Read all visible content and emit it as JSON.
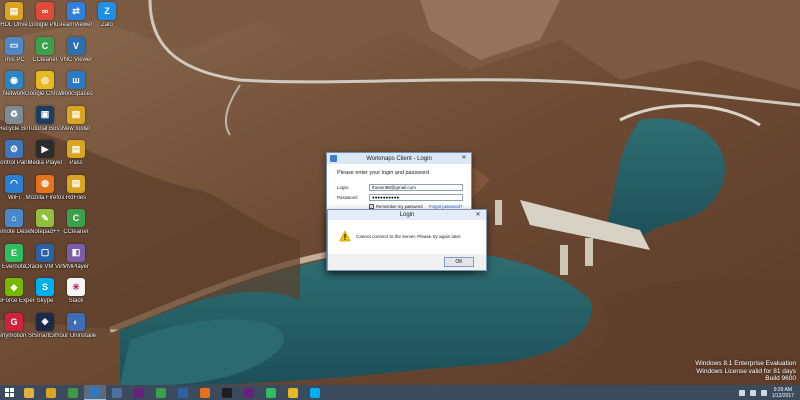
{
  "desktop_icons": [
    {
      "name": "folder-icon",
      "label": "HDL Drive",
      "color": "#d9a520",
      "glyph": "▤"
    },
    {
      "name": "google-plus-icon",
      "label": "Google Plus",
      "color": "#dd4b39",
      "glyph": "∞"
    },
    {
      "name": "teamviewer-icon",
      "label": "TeamViewer",
      "color": "#2f7fe0",
      "glyph": "⇄"
    },
    {
      "name": "zalo-icon",
      "label": "Zalo",
      "color": "#1d8fe6",
      "glyph": "Z"
    },
    {
      "name": "computer-icon",
      "label": "This PC",
      "color": "#4e88c7",
      "glyph": "▭"
    },
    {
      "name": "ccleaner-icon",
      "label": "CCleaner",
      "color": "#3aa04a",
      "glyph": "C"
    },
    {
      "name": "vnc-viewer-icon",
      "label": "VNC Viewer",
      "color": "#2e6fb0",
      "glyph": "V"
    },
    {
      "name": "network-icon",
      "label": "Network",
      "color": "#2b86c8",
      "glyph": "◉"
    },
    {
      "name": "chrome-icon",
      "label": "Google Chrome",
      "color": "#e8b821",
      "glyph": "◎"
    },
    {
      "name": "workspaces-icon",
      "label": "WorkSpaces",
      "color": "#2f78c4",
      "glyph": "ш"
    },
    {
      "name": "recycle-bin-icon",
      "label": "Recycle Bin",
      "color": "#7d8c99",
      "glyph": "♻"
    },
    {
      "name": "screen-icon",
      "label": "Tutorial Boss",
      "color": "#1c3d64",
      "glyph": "▣"
    },
    {
      "name": "new-folder-icon",
      "label": "New folder",
      "color": "#d9a520",
      "glyph": "▤"
    },
    {
      "name": "control-panel-icon",
      "label": "Control Panel",
      "color": "#3b78c0",
      "glyph": "⚙"
    },
    {
      "name": "media-player-icon",
      "label": "Media Player",
      "color": "#2c2c2c",
      "glyph": "▶"
    },
    {
      "name": "folder2-icon",
      "label": "Pass",
      "color": "#d9a520",
      "glyph": "▤"
    },
    {
      "name": "wifi-icon",
      "label": "WiFi",
      "color": "#2b7fd0",
      "glyph": "◠"
    },
    {
      "name": "firefox-icon",
      "label": "Mozilla Firefox",
      "color": "#e6731c",
      "glyph": "◍"
    },
    {
      "name": "folder3-icon",
      "label": "RdFiles",
      "color": "#d9a520",
      "glyph": "▤"
    },
    {
      "name": "remote-desktop-icon",
      "label": "Remote Desktop",
      "color": "#4a89c8",
      "glyph": "⌂"
    },
    {
      "name": "notepad-plus-icon",
      "label": "Notepad++",
      "color": "#8fbf3c",
      "glyph": "✎"
    },
    {
      "name": "ccleaner2-icon",
      "label": "CCleaner",
      "color": "#3aa04a",
      "glyph": "C"
    },
    {
      "name": "evernote-icon",
      "label": "Evernote",
      "color": "#2dbe60",
      "glyph": "E"
    },
    {
      "name": "virtualbox-icon",
      "label": "Oracle VM VirtualBox",
      "color": "#2a62a8",
      "glyph": "▢"
    },
    {
      "name": "vmware-icon",
      "label": "VMPlayer",
      "color": "#7b5ea8",
      "glyph": "◧"
    },
    {
      "name": "nvidia-icon",
      "label": "GeForce Experience",
      "color": "#76b900",
      "glyph": "◆"
    },
    {
      "name": "skype-icon",
      "label": "Skype",
      "color": "#00aff0",
      "glyph": "S"
    },
    {
      "name": "slack-icon",
      "label": "Slack",
      "color": "#f5f5f5",
      "glyph": "✳"
    },
    {
      "name": "genymotion-icon",
      "label": "Genymotion Shell",
      "color": "#d0213e",
      "glyph": "G"
    },
    {
      "name": "smartgit-icon",
      "label": "SmartGit",
      "color": "#1b2a48",
      "glyph": "◈"
    },
    {
      "name": "uninstaller-icon",
      "label": "Your Uninstaller!",
      "color": "#3d6db5",
      "glyph": "◐"
    }
  ],
  "login_dialog": {
    "title": "Workmaps Client - Login",
    "prompt": "Please enter your login and password",
    "login_label": "Login:",
    "login_value": "thuann88@gmail.com",
    "password_label": "Password:",
    "password_value": "●●●●●●●●●●",
    "remember_label": "Remember my password",
    "forgot_link": "Forgot password?",
    "close_glyph": "✕"
  },
  "error_dialog": {
    "title": "Login",
    "message": "Cannot connect to the server. Please try again later.",
    "ok_label": "OK",
    "close_glyph": "✕"
  },
  "watermark": {
    "line1": "Windows 8.1 Enterprise Evaluation",
    "line2": "Windows License valid for 81 days",
    "line3": "Build 9600"
  },
  "taskbar": {
    "items": [
      {
        "name": "taskbar-explorer-icon",
        "color": "#e3b23c"
      },
      {
        "name": "taskbar-folder-icon",
        "color": "#d9a520"
      },
      {
        "name": "taskbar-store-icon",
        "color": "#3c9a43"
      },
      {
        "name": "taskbar-workspaces-icon",
        "color": "#2f78c4",
        "active": true
      },
      {
        "name": "taskbar-app-icon",
        "color": "#4d6ea0"
      },
      {
        "name": "taskbar-visual-studio-icon",
        "color": "#68217a"
      },
      {
        "name": "taskbar-ccleaner-icon",
        "color": "#3aa04a"
      },
      {
        "name": "taskbar-virtualbox-icon",
        "color": "#2a62a8"
      },
      {
        "name": "taskbar-firefox-icon",
        "color": "#e6731c"
      },
      {
        "name": "taskbar-terminal-icon",
        "color": "#1e1e1e"
      },
      {
        "name": "taskbar-visual-studio2-icon",
        "color": "#68217a"
      },
      {
        "name": "taskbar-evernote-icon",
        "color": "#2dbe60"
      },
      {
        "name": "taskbar-chrome-icon",
        "color": "#e8b821"
      },
      {
        "name": "taskbar-skype-icon",
        "color": "#00aff0"
      }
    ],
    "clock_time": "9:29 AM",
    "clock_date": "1/12/2017"
  }
}
